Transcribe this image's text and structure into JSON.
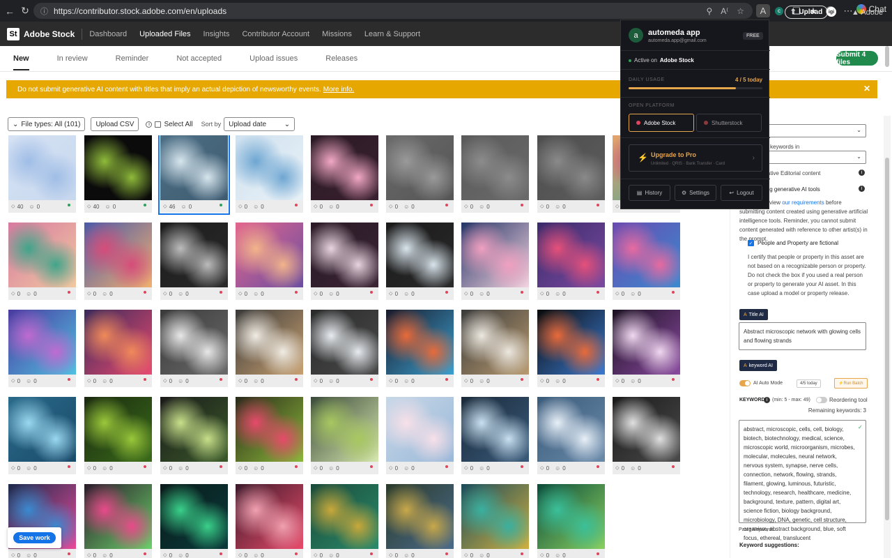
{
  "browser": {
    "url": "https://contributor.stock.adobe.com/en/uploads",
    "chat_label": "Chat",
    "ext_active_letter": "A",
    "ext_c_letter": "c"
  },
  "header": {
    "logo_letters": "St",
    "brand": "Adobe Stock",
    "nav": [
      "Dashboard",
      "Uploaded Files",
      "Insights",
      "Contributor Account",
      "Missions",
      "Learn & Support"
    ],
    "upload_label": "Upload",
    "avatar_letters": "igi",
    "adobe_label": "Adobe"
  },
  "tabs": [
    "New",
    "In review",
    "Reminder",
    "Not accepted",
    "Upload issues",
    "Releases"
  ],
  "submit_label": "Submit 4 files",
  "banner": {
    "text": "Do not submit generative AI content with titles that imply an actual depiction of newsworthy events.",
    "link": "More info."
  },
  "toolbar": {
    "file_types": "File types: All (101)",
    "upload_csv": "Upload CSV",
    "select_all": "Select All",
    "sort_by": "Sort by",
    "sort_value": "Upload date"
  },
  "save_label": "Save work",
  "tiles": [
    {
      "kw": "40",
      "ppl": "0",
      "status": "green",
      "colors": [
        "#d6e2f4",
        "#9fbde6",
        "#c8d8ee"
      ],
      "selected": false
    },
    {
      "kw": "40",
      "ppl": "0",
      "status": "green",
      "colors": [
        "#0b0b0b",
        "#8fbb3a",
        "#0b0b0b"
      ],
      "selected": false
    },
    {
      "kw": "46",
      "ppl": "0",
      "status": "green",
      "colors": [
        "#4d6f86",
        "#d7e6ee",
        "#3e5b70"
      ],
      "selected": true
    },
    {
      "kw": "0",
      "ppl": "0",
      "status": "red",
      "colors": [
        "#cfe1ef",
        "#6ea6d2",
        "#e9f1f7"
      ],
      "selected": false
    },
    {
      "kw": "0",
      "ppl": "0",
      "status": "red",
      "colors": [
        "#2a1a24",
        "#f2a8c4",
        "#3a2030"
      ],
      "selected": false
    },
    {
      "kw": "0",
      "ppl": "0",
      "status": "red",
      "colors": [
        "#6a6a6a",
        "#9a9a9a",
        "#555"
      ],
      "selected": false
    },
    {
      "kw": "0",
      "ppl": "0",
      "status": "red",
      "colors": [
        "#5a5a5a",
        "#8c8c8c",
        "#6a6a6a"
      ],
      "selected": false
    },
    {
      "kw": "0",
      "ppl": "0",
      "status": "red",
      "colors": [
        "#4e4e4e",
        "#8a8a8a",
        "#5c5c5c"
      ],
      "selected": false
    },
    {
      "kw": "0",
      "ppl": "0",
      "status": "red",
      "colors": [
        "#e9a26a",
        "#d64c7a",
        "#3aa89a"
      ],
      "selected": false
    },
    {
      "kw": "0",
      "ppl": "0",
      "status": "red",
      "colors": [
        "#d87aa0",
        "#3fa58a",
        "#f0c8a0"
      ],
      "selected": false
    },
    {
      "kw": "0",
      "ppl": "0",
      "status": "red",
      "colors": [
        "#4a5aa8",
        "#d64c7a",
        "#f2b070"
      ],
      "selected": false
    },
    {
      "kw": "0",
      "ppl": "0",
      "status": "red",
      "colors": [
        "#1c1c1c",
        "#bcbcbc",
        "#2a2a2a"
      ],
      "selected": false
    },
    {
      "kw": "0",
      "ppl": "0",
      "status": "red",
      "colors": [
        "#e4668e",
        "#f2b48a",
        "#6a4ea0"
      ],
      "selected": false
    },
    {
      "kw": "0",
      "ppl": "0",
      "status": "red",
      "colors": [
        "#2a1a26",
        "#e8d4e0",
        "#3a2434"
      ],
      "selected": false
    },
    {
      "kw": "0",
      "ppl": "0",
      "status": "red",
      "colors": [
        "#1a1a1a",
        "#d8e4ec",
        "#2a2a2a"
      ],
      "selected": false
    },
    {
      "kw": "0",
      "ppl": "0",
      "status": "red",
      "colors": [
        "#243466",
        "#f0a0c0",
        "#f4d4e0"
      ],
      "selected": false
    },
    {
      "kw": "0",
      "ppl": "0",
      "status": "red",
      "colors": [
        "#3a2a6a",
        "#e6507a",
        "#7a4aa0"
      ],
      "selected": false
    },
    {
      "kw": "0",
      "ppl": "0",
      "status": "red",
      "colors": [
        "#6a4ab0",
        "#e86aa0",
        "#3a8ad0"
      ],
      "selected": false
    },
    {
      "kw": "0",
      "ppl": "0",
      "status": "red",
      "colors": [
        "#4a3aa0",
        "#c06ad0",
        "#50c0e0"
      ],
      "selected": false
    },
    {
      "kw": "0",
      "ppl": "0",
      "status": "red",
      "colors": [
        "#3a2a5a",
        "#f08a5a",
        "#e84a70"
      ],
      "selected": false
    },
    {
      "kw": "0",
      "ppl": "0",
      "status": "red",
      "colors": [
        "#3a3a3a",
        "#e8e8e8",
        "#6a6a6a"
      ],
      "selected": false
    },
    {
      "kw": "0",
      "ppl": "0",
      "status": "red",
      "colors": [
        "#3a3a3a",
        "#f0ece4",
        "#c8a070"
      ],
      "selected": false
    },
    {
      "kw": "0",
      "ppl": "0",
      "status": "red",
      "colors": [
        "#2a2a2a",
        "#e8ecf0",
        "#4a4a4a"
      ],
      "selected": false
    },
    {
      "kw": "0",
      "ppl": "0",
      "status": "red",
      "colors": [
        "#1a1a2a",
        "#e86a3a",
        "#3aa0d0"
      ],
      "selected": false
    },
    {
      "kw": "0",
      "ppl": "0",
      "status": "red",
      "colors": [
        "#3a3a3a",
        "#ece8e0",
        "#b89a70"
      ],
      "selected": false
    },
    {
      "kw": "0",
      "ppl": "0",
      "status": "red",
      "colors": [
        "#0a0a0a",
        "#e86a3a",
        "#3a7ad0"
      ],
      "selected": false
    },
    {
      "kw": "0",
      "ppl": "0",
      "status": "red",
      "colors": [
        "#1a1020",
        "#f0d8f0",
        "#8a4aa0"
      ],
      "selected": false
    },
    {
      "kw": "0",
      "ppl": "0",
      "status": "red",
      "colors": [
        "#2a6a8a",
        "#9ad8f0",
        "#1a4a6a"
      ],
      "selected": false
    },
    {
      "kw": "0",
      "ppl": "0",
      "status": "red",
      "colors": [
        "#1a2a10",
        "#9ac83a",
        "#3a6a1a"
      ],
      "selected": false
    },
    {
      "kw": "0",
      "ppl": "0",
      "status": "red",
      "colors": [
        "#1a1a1a",
        "#c8e08a",
        "#3a5a2a"
      ],
      "selected": false
    },
    {
      "kw": "0",
      "ppl": "0",
      "status": "red",
      "colors": [
        "#2a2a1a",
        "#e64a6a",
        "#8ab83a"
      ],
      "selected": false
    },
    {
      "kw": "0",
      "ppl": "0",
      "status": "red",
      "colors": [
        "#3a4a3a",
        "#a8c860",
        "#d8e8b0"
      ],
      "selected": false
    },
    {
      "kw": "0",
      "ppl": "0",
      "status": "red",
      "colors": [
        "#c8d8e8",
        "#f8e0e8",
        "#9ab8d8"
      ],
      "selected": false
    },
    {
      "kw": "0",
      "ppl": "0",
      "status": "red",
      "colors": [
        "#1a2a3a",
        "#c8e0f0",
        "#3a5a7a"
      ],
      "selected": false
    },
    {
      "kw": "0",
      "ppl": "0",
      "status": "red",
      "colors": [
        "#3a5a7a",
        "#e8f0f8",
        "#6a8aaa"
      ],
      "selected": false
    },
    {
      "kw": "0",
      "ppl": "0",
      "status": "red",
      "colors": [
        "#1a1a1a",
        "#e0e0e0",
        "#4a4a4a"
      ],
      "selected": false
    },
    {
      "kw": "0",
      "ppl": "0",
      "status": "red",
      "colors": [
        "#1a2a4a",
        "#3a8ad0",
        "#e84a9a"
      ],
      "selected": false
    },
    {
      "kw": "0",
      "ppl": "0",
      "status": "red",
      "colors": [
        "#2a1a2a",
        "#e84a8a",
        "#6ad06a"
      ],
      "selected": false
    },
    {
      "kw": "0",
      "ppl": "0",
      "status": "red",
      "colors": [
        "#0a1a1a",
        "#3ad08a",
        "#0a3a3a"
      ],
      "selected": false
    },
    {
      "kw": "0",
      "ppl": "0",
      "status": "red",
      "colors": [
        "#3a1a2a",
        "#f0a0b0",
        "#e84a6a"
      ],
      "selected": false
    },
    {
      "kw": "0",
      "ppl": "0",
      "status": "red",
      "colors": [
        "#1a4a3a",
        "#c8a83a",
        "#2a8a6a"
      ],
      "selected": false
    },
    {
      "kw": "0",
      "ppl": "0",
      "status": "red",
      "colors": [
        "#2a3a2a",
        "#c8a84a",
        "#4a6a8a"
      ],
      "selected": false
    },
    {
      "kw": "0",
      "ppl": "0",
      "status": "red",
      "colors": [
        "#1a4a5a",
        "#3ab0a0",
        "#d0b040"
      ],
      "selected": false
    },
    {
      "kw": "0",
      "ppl": "0",
      "status": "red",
      "colors": [
        "#0a4a3a",
        "#3ac09a",
        "#8ad060"
      ],
      "selected": false
    }
  ],
  "panel": {
    "keywords_in": "keywords in",
    "editorial": "strative Editorial content",
    "genai_label": "ing generative AI tools",
    "req_text_a": "view",
    "req_link": "our requirements",
    "req_text_b": "before submitting",
    "req_text_c": "content created using generative artificial intelligence tools. Reminder, you cannot submit content generated with reference to other artist(s) in the prompt.",
    "fictional_label": "People and Property are fictional",
    "certify_text": "I certify that people or property in this asset are not based on a recognizable person or property. Do not check the box if you used a real person or property to generate your AI asset. In this case upload a model or property release.",
    "title_ai": "Title AI",
    "title_value": "Abstract microscopic network with glowing cells and flowing strands",
    "keyword_ai": "keyword AI",
    "auto_mode": "AI Auto Mode",
    "usage_badge": "4/5 today",
    "run_batch": "Run Batch",
    "keywords_label": "KEYWORDS",
    "keywords_range": "(min: 5 - max: 49)",
    "reordering": "Reordering tool",
    "remaining": "Remaining keywords: 3",
    "keywords_text": "abstract, microscopic, cells, cell, biology, biotech, biotechnology, medical, science, microscopic world, microorganism, microbes, molecular, molecules, neural network, nervous system, synapse, nerve cells, connection, network, flowing, strands, filament, glowing, luminous, futuristic, technology, research, healthcare, medicine, background, texture, pattern, digital art, science fiction, biology background, microbiology, DNA, genetic, cell structure, organism, abstract background, blue, soft focus, ethereal, translucent",
    "paste_keywords": "Paste Keywords...",
    "suggestions": "Keyword suggestions:"
  },
  "popup": {
    "avatar_letter": "a",
    "name": "automeda app",
    "email": "automeda.app@gmail.com",
    "plan": "FREE",
    "active_prefix": "Active on",
    "active_site": "Adobe Stock",
    "daily_usage_label": "DAILY USAGE",
    "usage_text": "4 / 5 today",
    "usage_fraction": 0.8,
    "open_platform_label": "OPEN PLATFORM",
    "platforms": [
      {
        "label": "Adobe Stock",
        "color": "#e0445a",
        "active": true
      },
      {
        "label": "Shutterstock",
        "color": "#8a3a3a",
        "active": false
      }
    ],
    "upgrade_title": "Upgrade to Pro",
    "upgrade_sub": "Unlimited · QRIS · Bank Transfer · Card",
    "buttons": [
      "History",
      "Settings",
      "Logout"
    ]
  },
  "colors": {
    "accent_blue": "#1473e6",
    "submit_green": "#1f8a4c",
    "banner_yellow": "#e6a800",
    "popup_orange": "#e6a64c",
    "status_green": "#2ea05a",
    "status_red": "#e0445a"
  }
}
